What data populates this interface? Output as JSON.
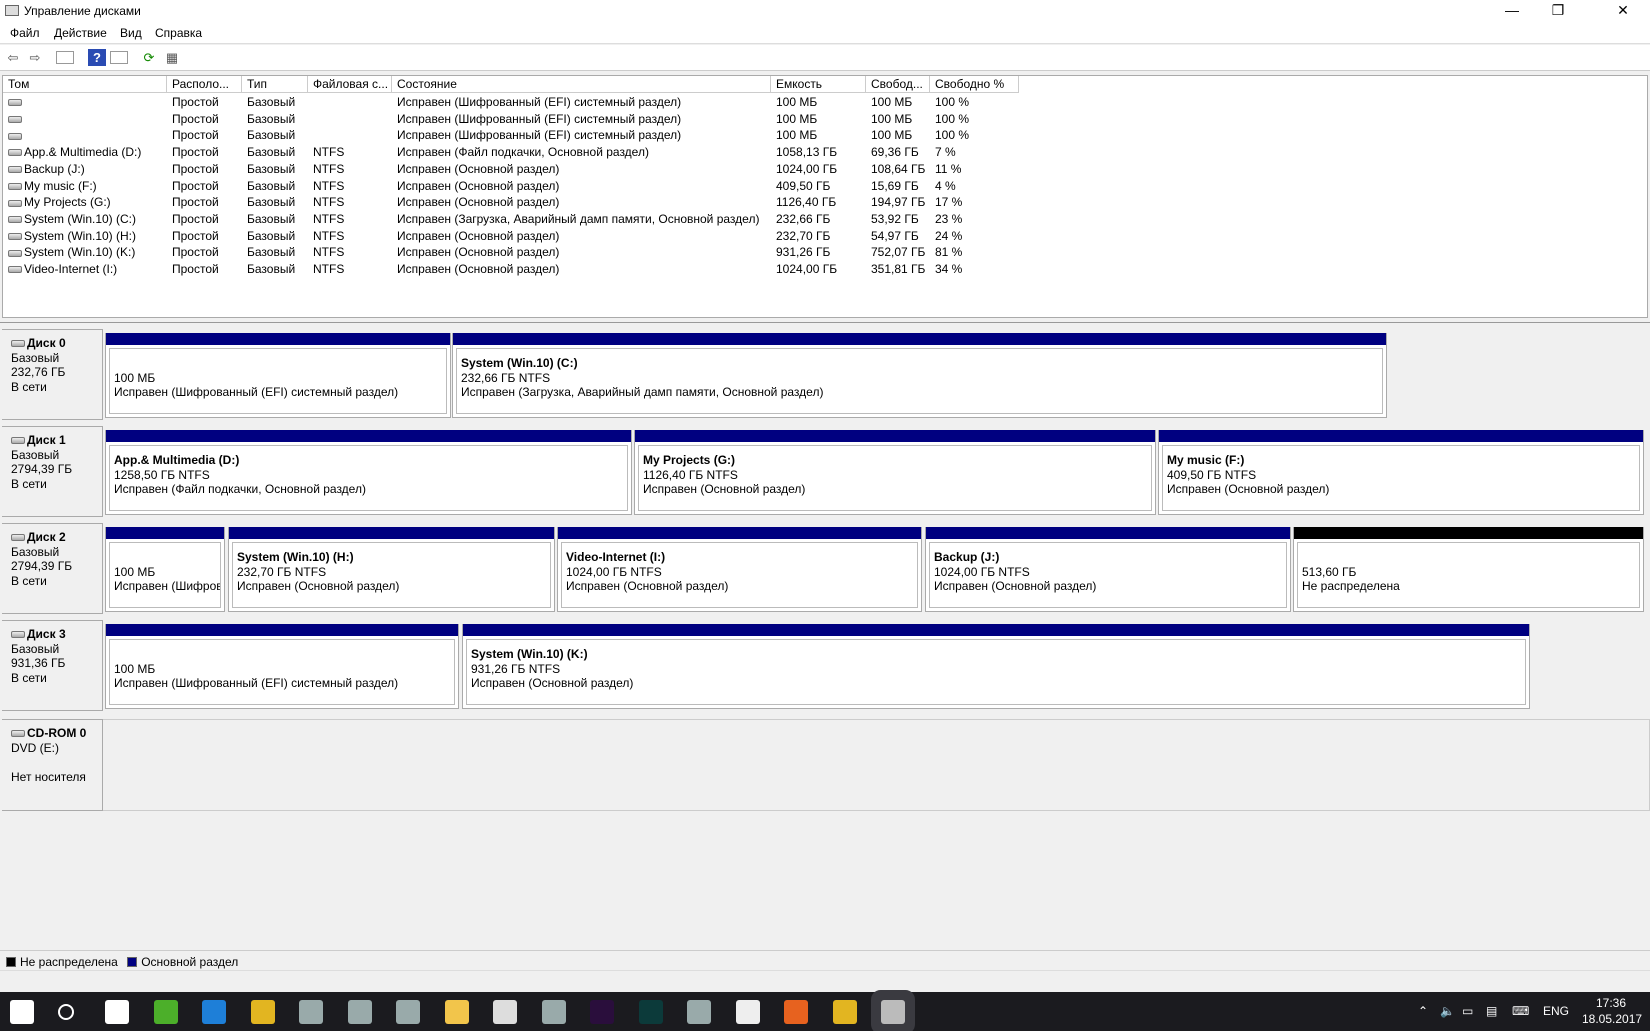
{
  "window": {
    "title": "Управление дисками",
    "minimize": "—",
    "restore": "❐",
    "close": "✕"
  },
  "menu": [
    "Файл",
    "Действие",
    "Вид",
    "Справка"
  ],
  "toolbar": [
    "back-icon",
    "forward-icon",
    "console-tree-icon",
    "help-icon",
    "action-pane-icon",
    "refresh-icon",
    "properties-icon"
  ],
  "columns": [
    "Том",
    "Располо...",
    "Тип",
    "Файловая с...",
    "Состояние",
    "Емкость",
    "Свобод...",
    "Свободно %"
  ],
  "volumes": [
    [
      "",
      "Простой",
      "Базовый",
      "",
      "Исправен (Шифрованный (EFI) системный раздел)",
      "100 МБ",
      "100 МБ",
      "100 %"
    ],
    [
      "",
      "Простой",
      "Базовый",
      "",
      "Исправен (Шифрованный (EFI) системный раздел)",
      "100 МБ",
      "100 МБ",
      "100 %"
    ],
    [
      "",
      "Простой",
      "Базовый",
      "",
      "Исправен (Шифрованный (EFI) системный раздел)",
      "100 МБ",
      "100 МБ",
      "100 %"
    ],
    [
      "App.& Multimedia (D:)",
      "Простой",
      "Базовый",
      "NTFS",
      "Исправен (Файл подкачки, Основной раздел)",
      "1058,13 ГБ",
      "69,36 ГБ",
      "7 %"
    ],
    [
      "Backup (J:)",
      "Простой",
      "Базовый",
      "NTFS",
      "Исправен (Основной раздел)",
      "1024,00 ГБ",
      "108,64 ГБ",
      "11 %"
    ],
    [
      "My music (F:)",
      "Простой",
      "Базовый",
      "NTFS",
      "Исправен (Основной раздел)",
      "409,50 ГБ",
      "15,69 ГБ",
      "4 %"
    ],
    [
      "My Projects  (G:)",
      "Простой",
      "Базовый",
      "NTFS",
      "Исправен (Основной раздел)",
      "1126,40 ГБ",
      "194,97 ГБ",
      "17 %"
    ],
    [
      "System (Win.10) (C:)",
      "Простой",
      "Базовый",
      "NTFS",
      "Исправен (Загрузка, Аварийный дамп памяти, Основной раздел)",
      "232,66 ГБ",
      "53,92 ГБ",
      "23 %"
    ],
    [
      "System (Win.10) (H:)",
      "Простой",
      "Базовый",
      "NTFS",
      "Исправен (Основной раздел)",
      "232,70 ГБ",
      "54,97 ГБ",
      "24 %"
    ],
    [
      "System (Win.10) (K:)",
      "Простой",
      "Базовый",
      "NTFS",
      "Исправен (Основной раздел)",
      "931,26 ГБ",
      "752,07 ГБ",
      "81 %"
    ],
    [
      "Video-Internet (I:)",
      "Простой",
      "Базовый",
      "NTFS",
      "Исправен (Основной раздел)",
      "1024,00 ГБ",
      "351,81 ГБ",
      "34 %"
    ]
  ],
  "disks": [
    {
      "name": "Диск 0",
      "type": "Базовый",
      "size": "232,76 ГБ",
      "status": "В сети",
      "partitions": [
        {
          "title": "",
          "size": "100 МБ",
          "status": "Исправен (Шифрованный (EFI) системный раздел)",
          "kind": "primary"
        },
        {
          "title": "System (Win.10)  (C:)",
          "size": "232,66 ГБ NTFS",
          "status": "Исправен (Загрузка, Аварийный дамп памяти, Основной раздел)",
          "kind": "primary"
        }
      ]
    },
    {
      "name": "Диск 1",
      "type": "Базовый",
      "size": "2794,39 ГБ",
      "status": "В сети",
      "partitions": [
        {
          "title": "App.& Multimedia  (D:)",
          "size": "1258,50 ГБ NTFS",
          "status": "Исправен (Файл подкачки, Основной раздел)",
          "kind": "primary"
        },
        {
          "title": "My Projects   (G:)",
          "size": "1126,40 ГБ NTFS",
          "status": "Исправен (Основной раздел)",
          "kind": "primary"
        },
        {
          "title": "My music  (F:)",
          "size": "409,50 ГБ NTFS",
          "status": "Исправен (Основной раздел)",
          "kind": "primary"
        }
      ]
    },
    {
      "name": "Диск 2",
      "type": "Базовый",
      "size": "2794,39 ГБ",
      "status": "В сети",
      "partitions": [
        {
          "title": "",
          "size": "100 МБ",
          "status": "Исправен (Шифров",
          "kind": "primary"
        },
        {
          "title": "System (Win.10)  (H:)",
          "size": "232,70 ГБ NTFS",
          "status": "Исправен (Основной раздел)",
          "kind": "primary"
        },
        {
          "title": "Video-Internet  (I:)",
          "size": "1024,00 ГБ NTFS",
          "status": "Исправен (Основной раздел)",
          "kind": "primary"
        },
        {
          "title": "Backup  (J:)",
          "size": "1024,00 ГБ NTFS",
          "status": "Исправен (Основной раздел)",
          "kind": "primary"
        },
        {
          "title": "",
          "size": "513,60 ГБ",
          "status": "Не распределена",
          "kind": "unallocated"
        }
      ]
    },
    {
      "name": "Диск 3",
      "type": "Базовый",
      "size": "931,36 ГБ",
      "status": "В сети",
      "partitions": [
        {
          "title": "",
          "size": "100 МБ",
          "status": "Исправен (Шифрованный (EFI) системный раздел)",
          "kind": "primary"
        },
        {
          "title": "System (Win.10)  (K:)",
          "size": "931,26 ГБ NTFS",
          "status": "Исправен (Основной раздел)",
          "kind": "primary"
        }
      ]
    },
    {
      "name": "CD-ROM 0",
      "type": "DVD (E:)",
      "size": "",
      "status": "Нет носителя",
      "partitions": []
    }
  ],
  "legend": [
    {
      "label": "Не распределена",
      "color": "#000000"
    },
    {
      "label": "Основной раздел",
      "color": "#000080"
    }
  ],
  "taskbar": {
    "apps": [
      "start",
      "search",
      "store",
      "utorrent",
      "edge",
      "chrome",
      "app",
      "app",
      "app",
      "explorer",
      "calculator",
      "app",
      "premiere",
      "speedgrade",
      "app",
      "mail",
      "firefox",
      "chrome",
      "disk-management"
    ],
    "lang": "ENG",
    "time": "17:36",
    "date": "18.05.2017"
  }
}
